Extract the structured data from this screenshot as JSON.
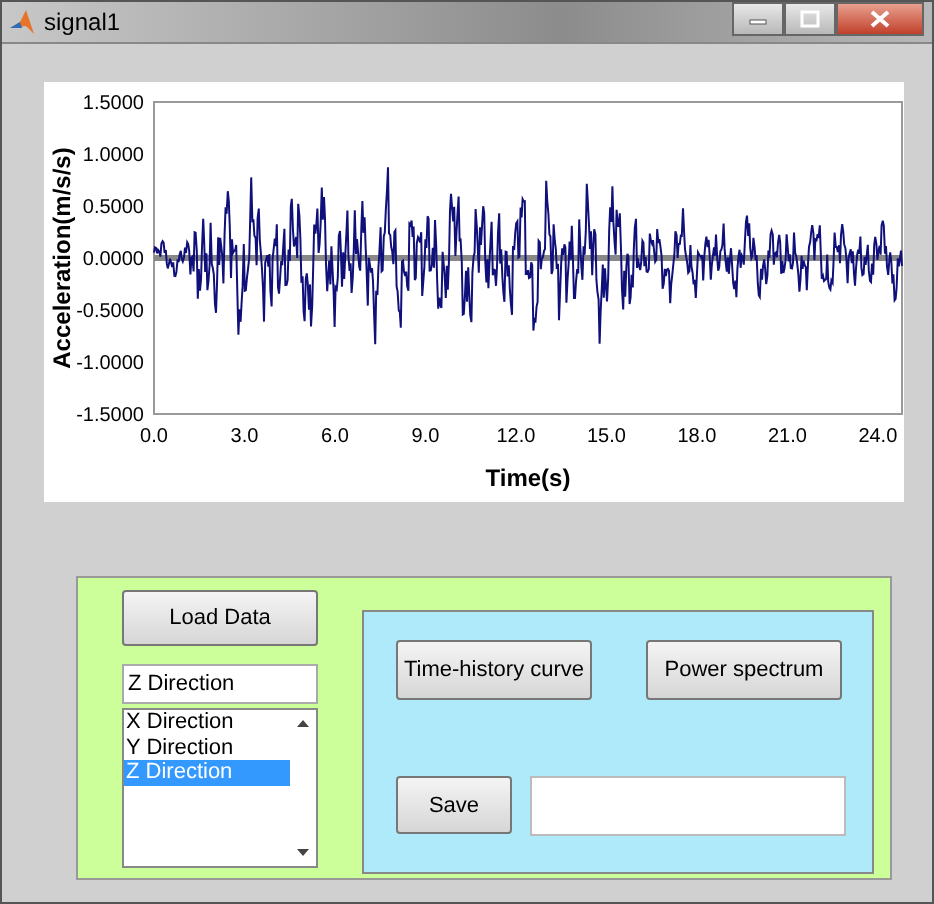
{
  "window": {
    "title": "signal1"
  },
  "plot": {
    "ylabel": "Acceleration(m/s/s)",
    "xlabel": "Time(s)",
    "yticks": [
      "1.5000",
      "1.0000",
      "0.5000",
      "0.0000",
      "-0.5000",
      "-1.0000",
      "-1.5000"
    ],
    "xticks": [
      "0.0",
      "3.0",
      "6.0",
      "9.0",
      "12.0",
      "15.0",
      "18.0",
      "21.0",
      "24.0"
    ]
  },
  "controls": {
    "load_button": "Load Data",
    "selected_field": {
      "value": "Z Direction"
    },
    "listbox": [
      {
        "label": "X Direction",
        "selected": false
      },
      {
        "label": "Y Direction",
        "selected": false
      },
      {
        "label": "Z Direction",
        "selected": true
      }
    ],
    "buttons": [
      "Time-history curve",
      "Power spectrum"
    ],
    "save_button": "Save"
  }
}
